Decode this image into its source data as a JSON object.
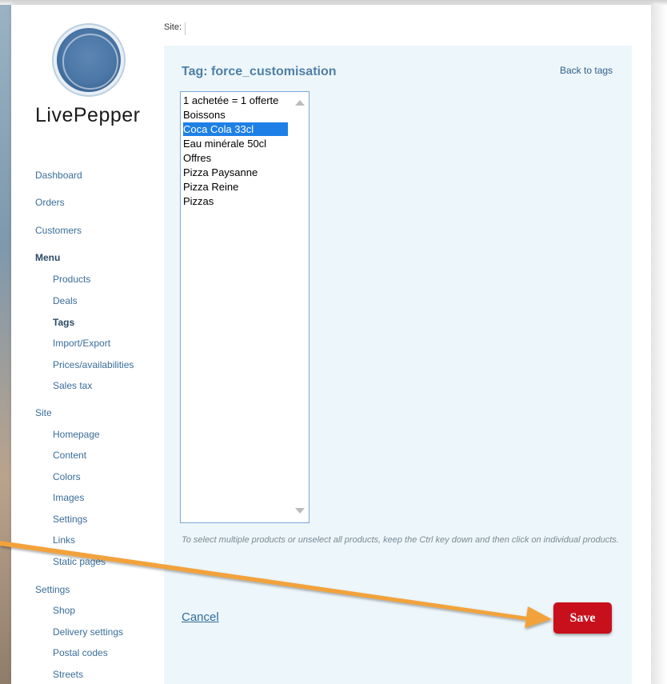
{
  "site_label": "Site:",
  "logo": {
    "text": "LivePepper"
  },
  "nav": {
    "dashboard": "Dashboard",
    "orders": "Orders",
    "customers": "Customers",
    "menu": "Menu",
    "products": "Products",
    "deals": "Deals",
    "tags": "Tags",
    "import_export": "Import/Export",
    "prices": "Prices/availabilities",
    "sales_tax": "Sales tax",
    "site": "Site",
    "homepage": "Homepage",
    "content": "Content",
    "colors": "Colors",
    "images": "Images",
    "site_settings": "Settings",
    "links": "Links",
    "static_pages": "Static pages",
    "settings": "Settings",
    "shop": "Shop",
    "delivery_settings": "Delivery settings",
    "postal_codes": "Postal codes",
    "streets": "Streets"
  },
  "content": {
    "title": "Tag: force_customisation",
    "back_link": "Back to tags",
    "products": [
      {
        "label": "1 achetée = 1 offerte",
        "selected": false
      },
      {
        "label": "Boissons",
        "selected": false
      },
      {
        "label": "Coca Cola 33cl",
        "selected": true
      },
      {
        "label": "Eau minérale 50cl",
        "selected": false
      },
      {
        "label": "Offres",
        "selected": false
      },
      {
        "label": "Pizza Paysanne",
        "selected": false
      },
      {
        "label": "Pizza Reine",
        "selected": false
      },
      {
        "label": "Pizzas",
        "selected": false
      }
    ],
    "help_text": "To select multiple products or unselect all products, keep the Ctrl key down and then click on individual products.",
    "cancel_label": "Cancel",
    "save_label": "Save"
  },
  "colors": {
    "accent_blue": "#4f7fa6",
    "link_blue": "#3a6d9a",
    "selection_blue": "#1e80e6",
    "save_red": "#c8101d",
    "panel_bg": "#edf6fa",
    "annotation_orange": "#f2a23a"
  }
}
